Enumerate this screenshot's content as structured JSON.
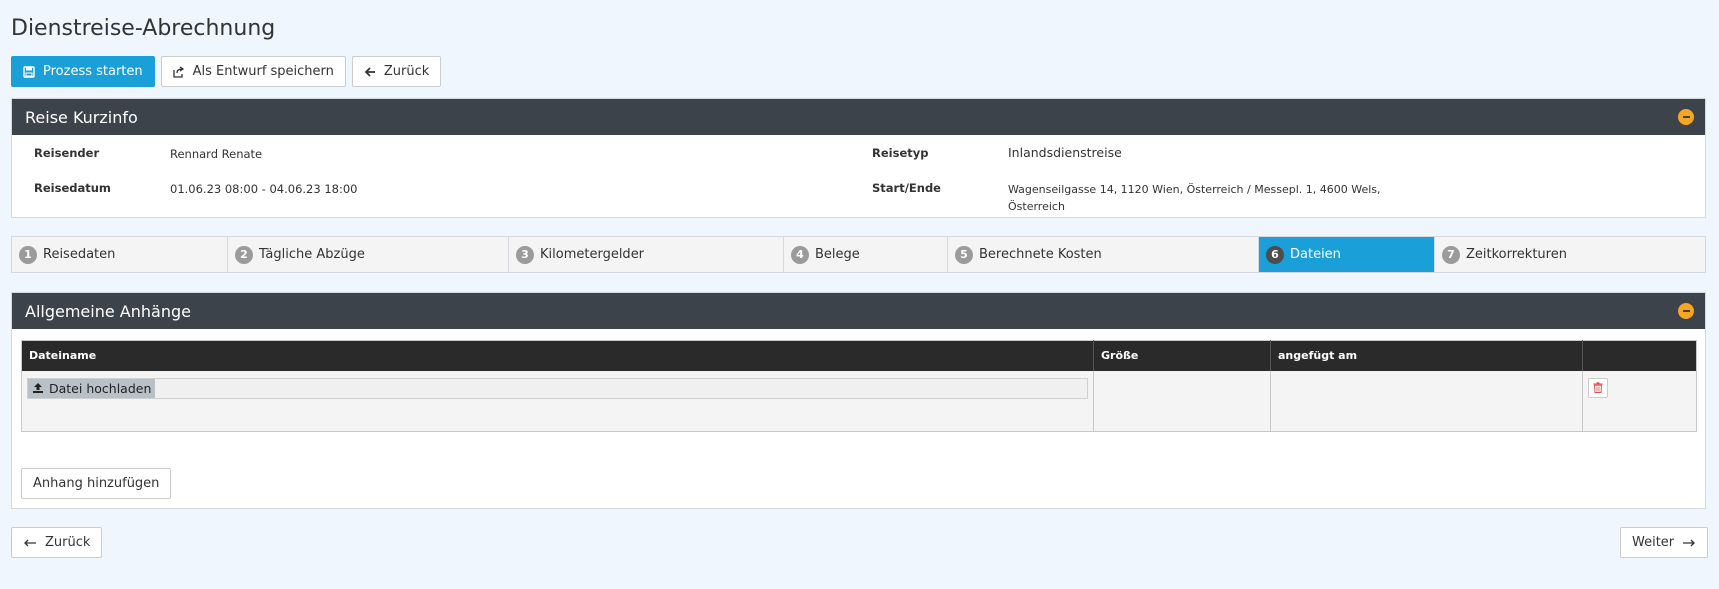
{
  "page": {
    "title": "Dienstreise-Abrechnung"
  },
  "toolbar": {
    "start_label": "Prozess starten",
    "draft_label": "Als Entwurf speichern",
    "back_label": "Zurück"
  },
  "kurzinfo": {
    "title": "Reise Kurzinfo",
    "reisender_label": "Reisender",
    "reisender_value": "Rennard Renate",
    "reisedatum_label": "Reisedatum",
    "reisedatum_value": "01.06.23 08:00 - 04.06.23 18:00",
    "reisetyp_label": "Reisetyp",
    "reisetyp_value": "Inlandsdienstreise",
    "startende_label": "Start/Ende",
    "startende_line1": "Wagenseilgasse 14, 1120 Wien, Österreich / Messepl. 1, 4600 Wels,",
    "startende_line2": "Österreich"
  },
  "steps": [
    {
      "num": "1",
      "label": "Reisedaten"
    },
    {
      "num": "2",
      "label": "Tägliche Abzüge"
    },
    {
      "num": "3",
      "label": "Kilometergelder"
    },
    {
      "num": "4",
      "label": "Belege"
    },
    {
      "num": "5",
      "label": "Berechnete Kosten"
    },
    {
      "num": "6",
      "label": "Dateien",
      "active": true
    },
    {
      "num": "7",
      "label": "Zeitkorrekturen"
    }
  ],
  "anhaenge": {
    "title": "Allgemeine Anhänge",
    "columns": [
      "Dateiname",
      "Größe",
      "angefügt am",
      ""
    ],
    "upload_label": "Datei hochladen",
    "add_label": "Anhang hinzufügen"
  },
  "nav": {
    "back_label": "Zurück",
    "next_label": "Weiter"
  },
  "colors": {
    "accent": "#1a9fd8",
    "panel_header": "#3d434a",
    "collapse": "#f5a623",
    "delete": "#d9534f"
  }
}
